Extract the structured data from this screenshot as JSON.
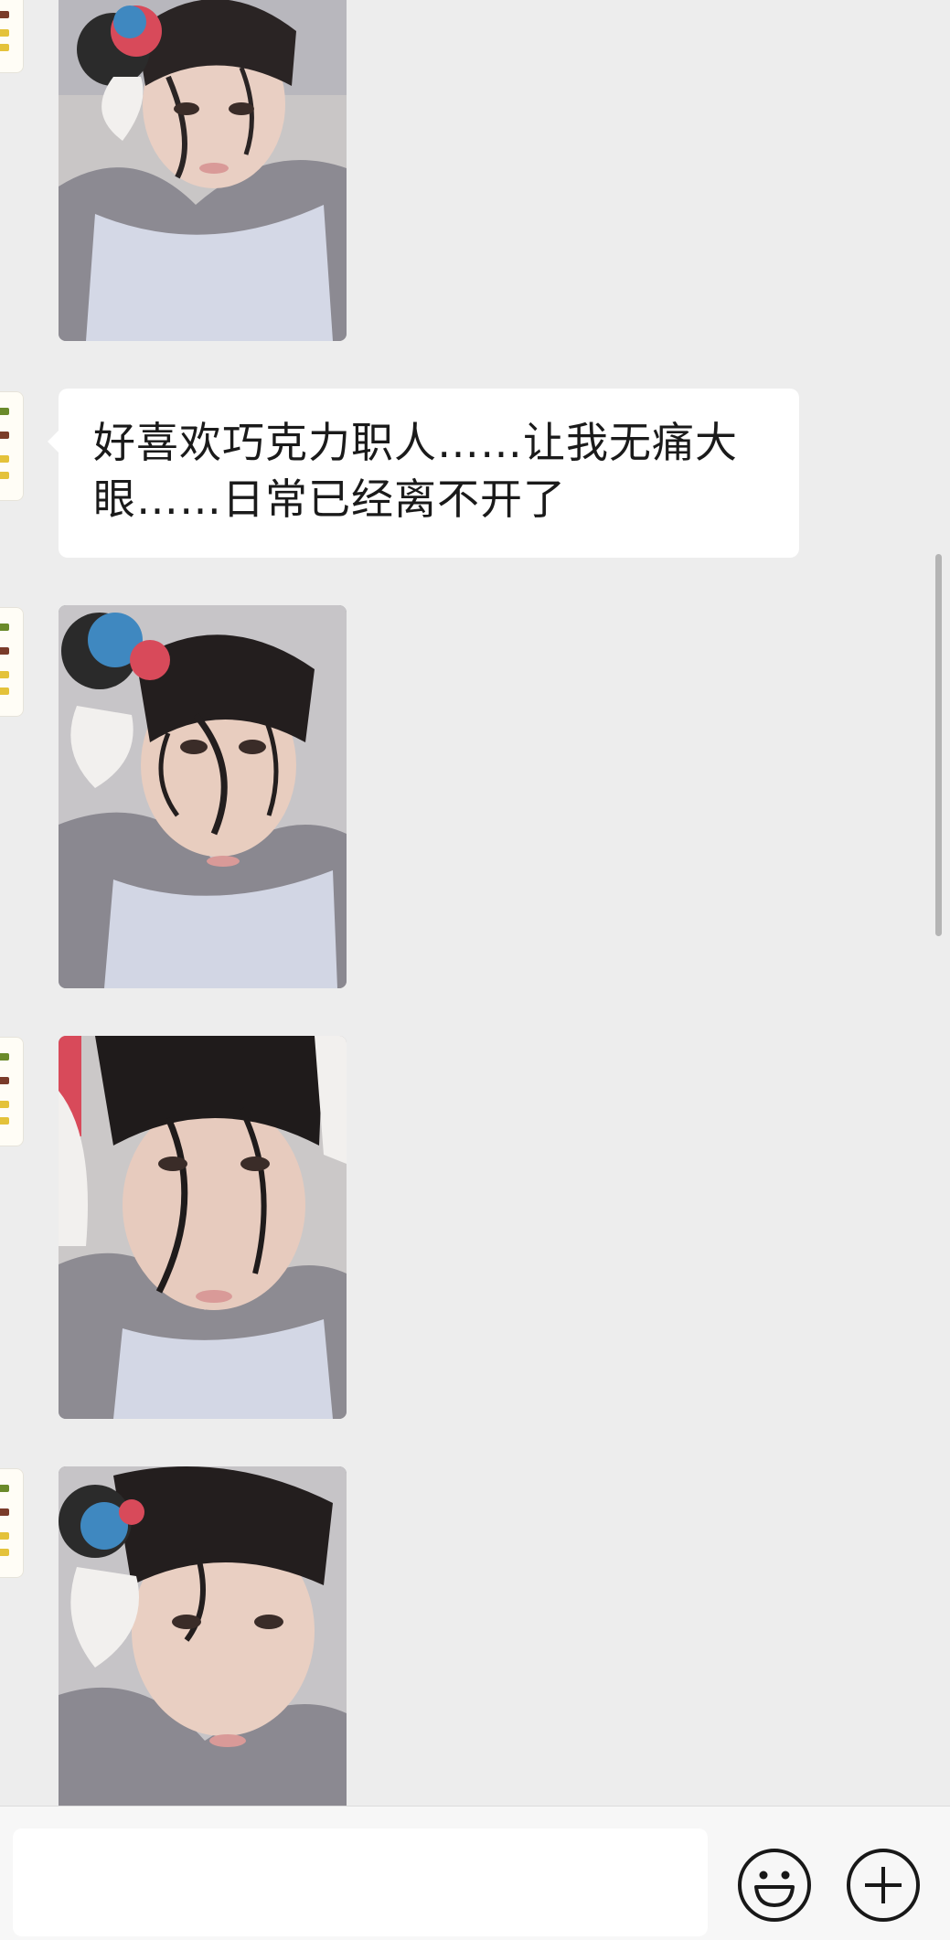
{
  "conversation": {
    "messages": [
      {
        "kind": "image",
        "image": "selfie-with-hair-rollers-1"
      },
      {
        "kind": "text",
        "text": "好喜欢巧克力职人……让我无痛大眼……日常已经离不开了"
      },
      {
        "kind": "image",
        "image": "selfie-with-hair-rollers-2"
      },
      {
        "kind": "image",
        "image": "selfie-with-hair-rollers-3"
      },
      {
        "kind": "image",
        "image": "selfie-with-hair-rollers-4"
      }
    ],
    "sender_avatar": "sticker-avatar"
  },
  "input_bar": {
    "message_value": "",
    "emoji_icon": "emoji-icon",
    "plus_icon": "plus-icon"
  },
  "colors": {
    "chat_background": "#ededed",
    "bubble": "#ffffff",
    "text": "#1a1a1a",
    "input_bar": "#f7f7f7"
  }
}
